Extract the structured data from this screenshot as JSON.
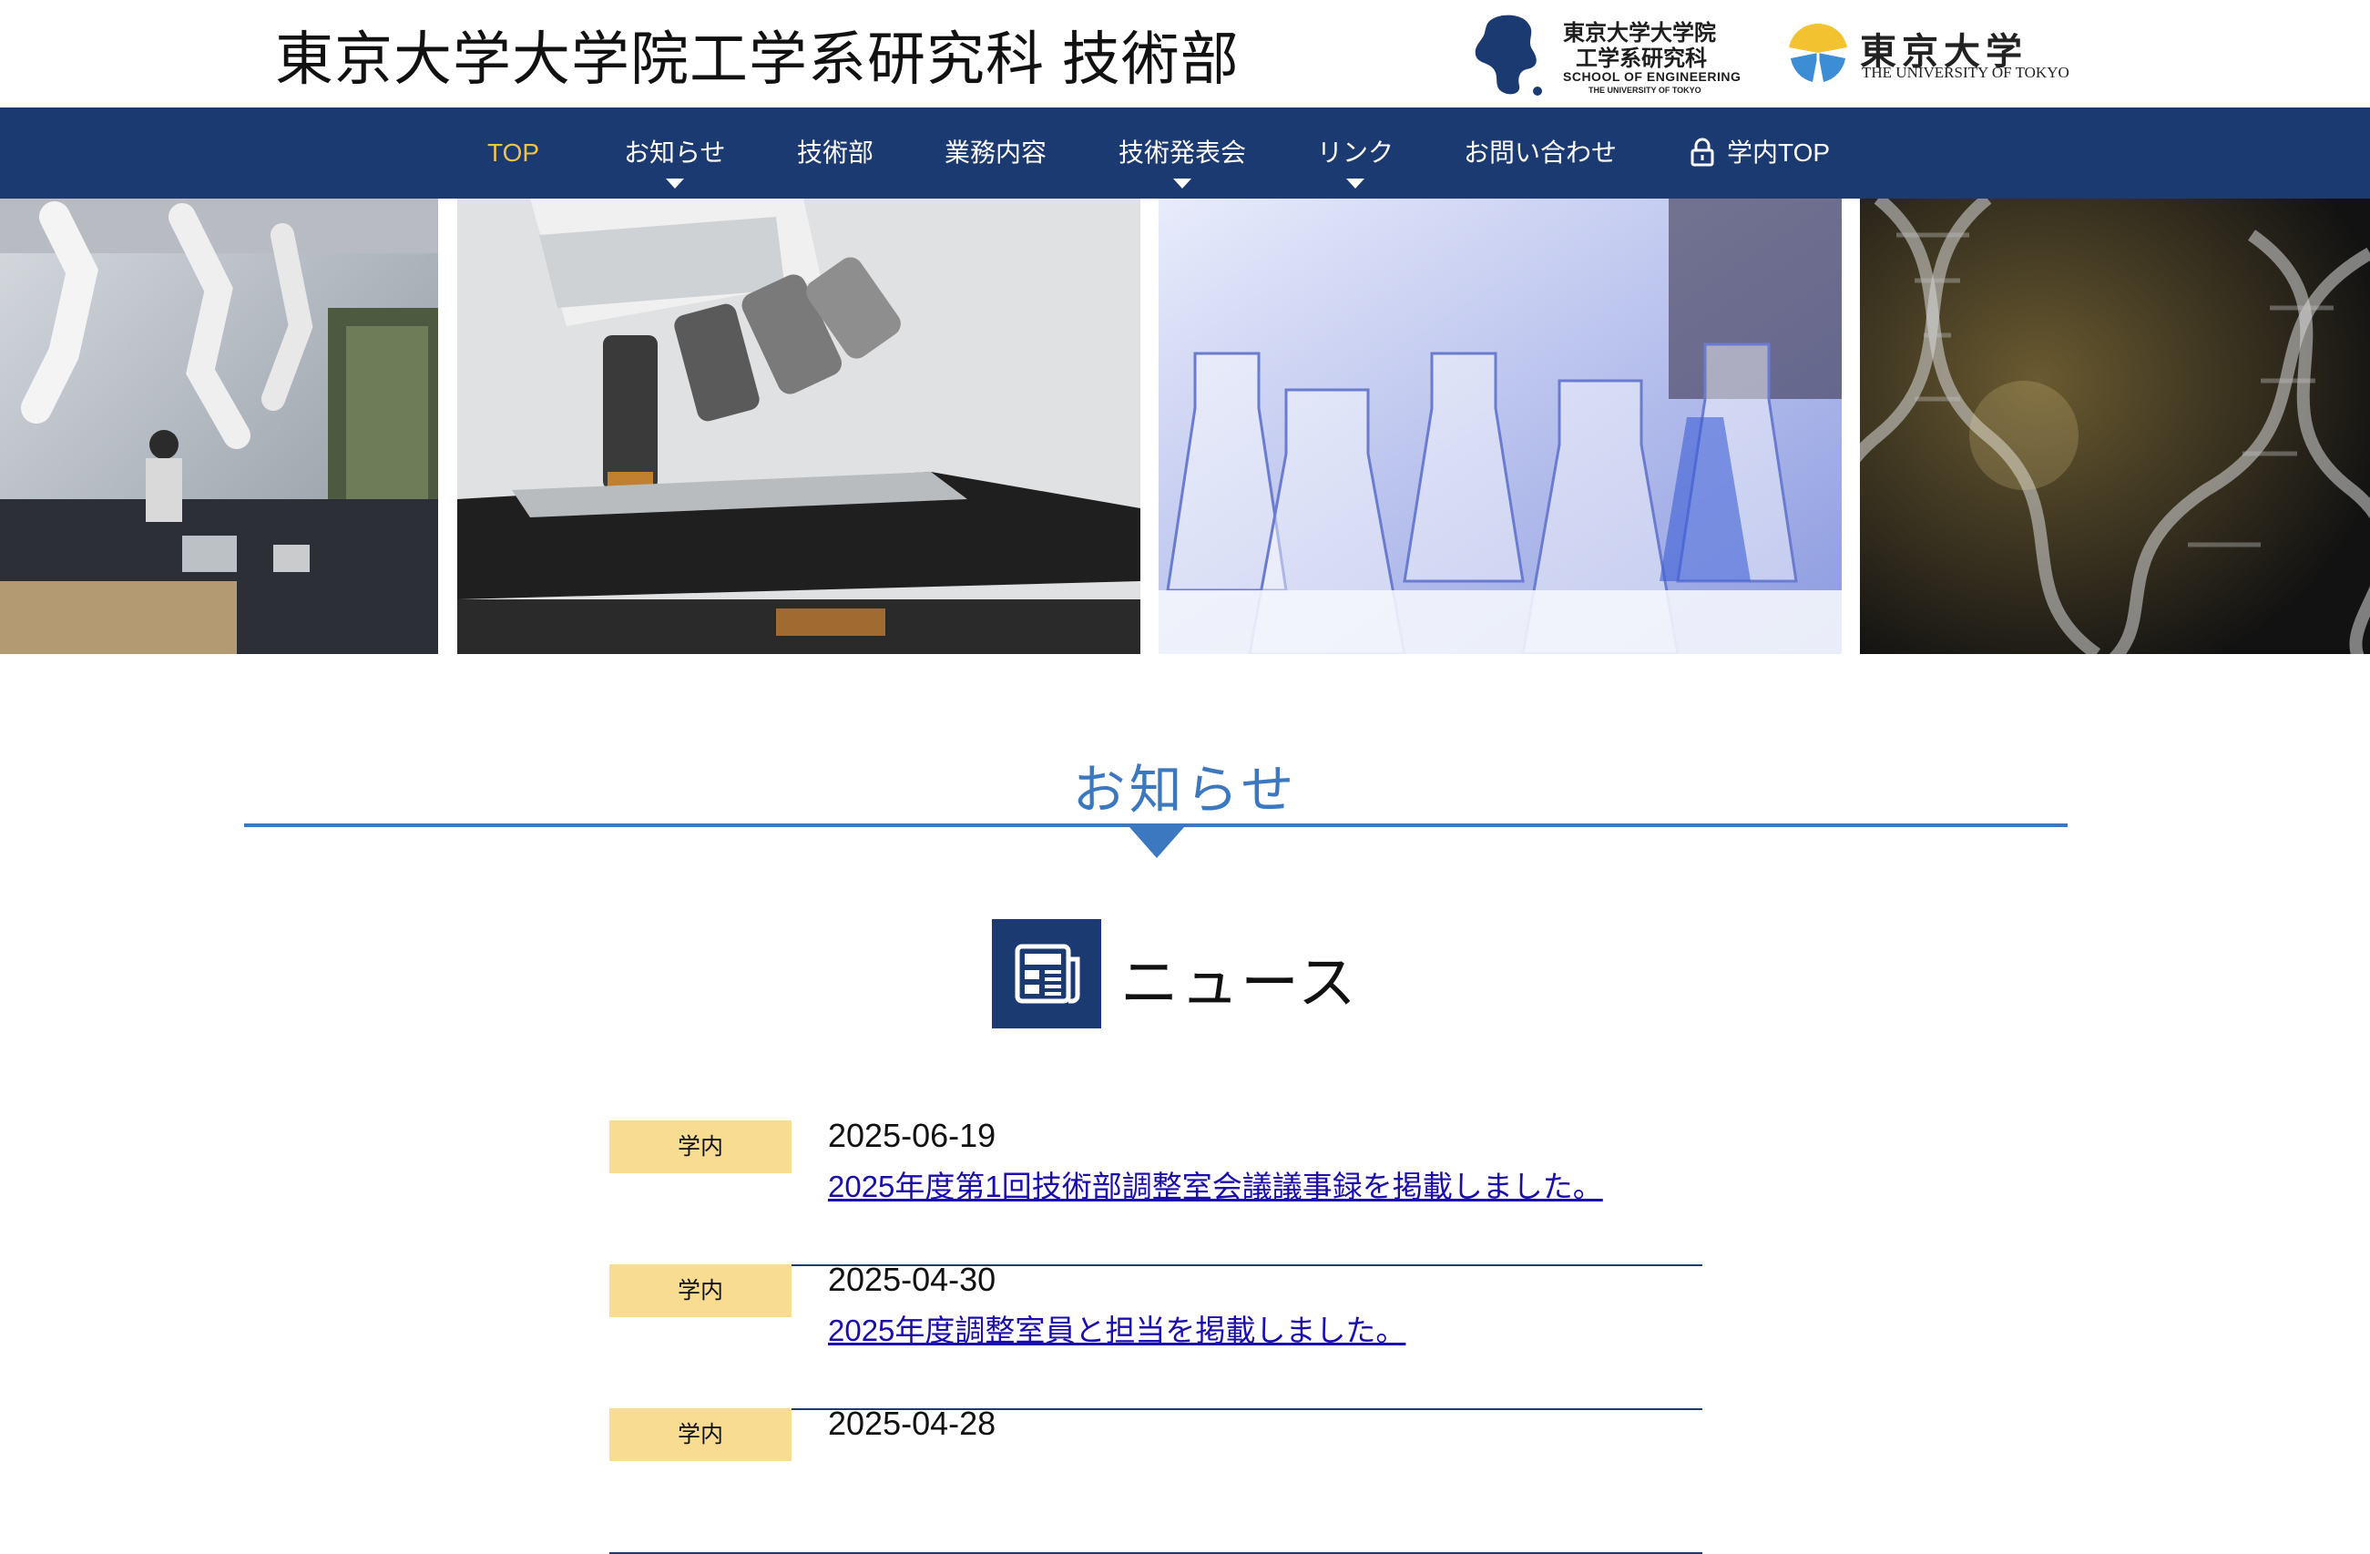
{
  "header": {
    "site_title": "東京大学大学院工学系研究科 技術部",
    "logo_engineering": {
      "line1": "東京大学大学院",
      "line2": "工学系研究科",
      "line3": "SCHOOL OF ENGINEERING",
      "line4": "THE UNIVERSITY OF TOKYO"
    },
    "logo_utokyo": {
      "line1": "東京大学",
      "line2": "THE UNIVERSITY OF TOKYO"
    }
  },
  "nav": {
    "items": [
      {
        "label": "TOP",
        "active": true
      },
      {
        "label": "お知らせ",
        "has_dropdown": true
      },
      {
        "label": "技術部"
      },
      {
        "label": "業務内容"
      },
      {
        "label": "技術発表会",
        "has_dropdown": true
      },
      {
        "label": "リンク",
        "has_dropdown": true
      },
      {
        "label": "お問い合わせ"
      },
      {
        "label": "学内TOP",
        "icon": "lock-icon"
      }
    ],
    "colors": {
      "background": "#1b3a72",
      "active": "#f0c14b"
    }
  },
  "hero": {
    "panels": [
      "lab-robot-arms-photo",
      "microscope-photo",
      "flasks-photo",
      "dna-helix-photo"
    ]
  },
  "section": {
    "title": "お知らせ",
    "color": "#3b78c0"
  },
  "news": {
    "heading": "ニュース",
    "icon": "newspaper-icon",
    "items": [
      {
        "tag": "学内",
        "date": "2025-06-19",
        "title": "2025年度第1回技術部調整室会議議事録を掲載しました。"
      },
      {
        "tag": "学内",
        "date": "2025-04-30",
        "title": "2025年度調整室員と担当を掲載しました。"
      },
      {
        "tag": "学内",
        "date": "2025-04-28",
        "title": ""
      }
    ]
  }
}
